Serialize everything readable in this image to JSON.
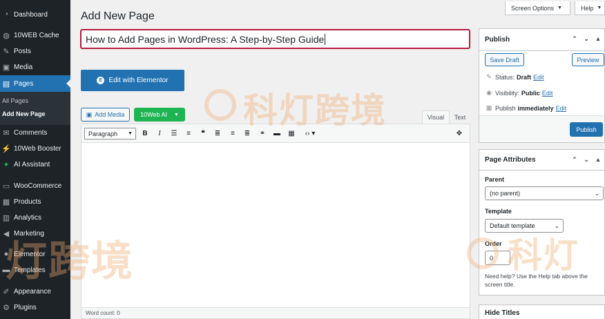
{
  "sidebar": {
    "items": [
      {
        "label": "Dashboard",
        "icon": "dashboard-icon"
      },
      {
        "label": "10WEB Cache",
        "icon": "cache-icon"
      },
      {
        "label": "Posts",
        "icon": "pin-icon"
      },
      {
        "label": "Media",
        "icon": "media-icon"
      },
      {
        "label": "Pages",
        "icon": "pages-icon"
      },
      {
        "label": "Comments",
        "icon": "comments-icon"
      },
      {
        "label": "10Web Booster",
        "icon": "booster-icon"
      },
      {
        "label": "AI Assistant",
        "icon": "sparkle-icon"
      },
      {
        "label": "WooCommerce",
        "icon": "woo-icon"
      },
      {
        "label": "Products",
        "icon": "products-icon"
      },
      {
        "label": "Analytics",
        "icon": "analytics-icon"
      },
      {
        "label": "Marketing",
        "icon": "marketing-icon"
      },
      {
        "label": "Elementor",
        "icon": "elementor-icon"
      },
      {
        "label": "Templates",
        "icon": "folder-icon"
      },
      {
        "label": "Appearance",
        "icon": "appearance-icon"
      },
      {
        "label": "Plugins",
        "icon": "plugins-icon"
      }
    ],
    "submenu": [
      "All Pages",
      "Add New Page"
    ]
  },
  "header": {
    "page_title": "Add New Page",
    "screen_options": "Screen Options",
    "help": "Help"
  },
  "editor": {
    "title_value": "How to Add Pages in WordPress: A Step-by-Step Guide",
    "elementor_button": "Edit with Elementor",
    "add_media": "Add Media",
    "ai_button": "10Web AI",
    "tab_visual": "Visual",
    "tab_text": "Text",
    "format_select": "Paragraph",
    "word_count": "Word count: 0"
  },
  "publish": {
    "heading": "Publish",
    "save_draft": "Save Draft",
    "preview": "Preview",
    "status_label": "Status:",
    "status_value": "Draft",
    "visibility_label": "Visibility:",
    "visibility_value": "Public",
    "publish_label": "Publish",
    "publish_value": "immediately",
    "edit": "Edit",
    "publish_button": "Publish"
  },
  "page_attributes": {
    "heading": "Page Attributes",
    "parent_label": "Parent",
    "parent_value": "(no parent)",
    "template_label": "Template",
    "template_value": "Default template",
    "order_label": "Order",
    "order_value": "0",
    "help_text": "Need help? Use the Help tab above the screen title."
  },
  "hide_titles": {
    "heading": "Hide Titles"
  },
  "watermark": {
    "text_top": "科灯跨境",
    "text_left": "灯跨境",
    "text_right": "科灯"
  },
  "colors": {
    "sidebar_bg": "#1d2327",
    "accent": "#2271b1",
    "title_border": "#b3193b",
    "ai_green": "#1fb452"
  }
}
